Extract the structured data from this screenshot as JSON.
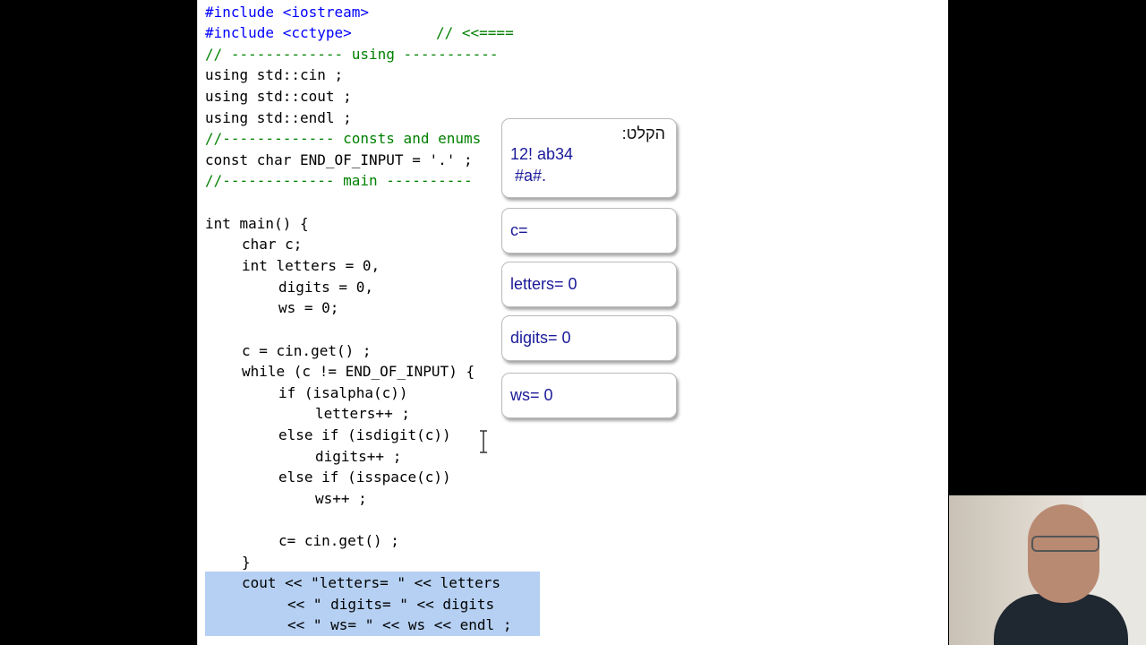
{
  "code_lines": [
    "#include <iostream>",
    "#include <cctype>",
    "// <<====",
    "// ------------- using -----------",
    "using std::cin ;",
    "using std::cout ;",
    "using std::endl ;",
    "//------------- consts and enums",
    "const char END_OF_INPUT = '.' ;",
    "//------------- main ----------",
    "int main() {",
    "char c;",
    "int letters = 0,",
    "digits = 0,",
    "ws = 0;",
    "c = cin.get() ;",
    "while (c != END_OF_INPUT) {",
    "if (isalpha(c))",
    "letters++ ;",
    "else if (isdigit(c))",
    "digits++ ;",
    "else if (isspace(c))",
    "ws++ ;",
    "c= cin.get() ;",
    "}",
    "cout << \"letters= \" << letters",
    "<< \" digits= \" << digits",
    "<< \" ws= \" << ws << endl ;"
  ],
  "panel": {
    "input_label": "הקלט:",
    "input_line1": "12! ab34",
    "input_line2": "#a#.",
    "c_label": "c=",
    "letters_label": "letters= 0",
    "digits_label": "digits= 0",
    "ws_label": "ws= 0"
  },
  "colors": {
    "keyword": "#0000ff",
    "comment": "#008000",
    "string": "#a31515",
    "selection": "#b5d0f2",
    "panel_text": "#1a1a99"
  }
}
